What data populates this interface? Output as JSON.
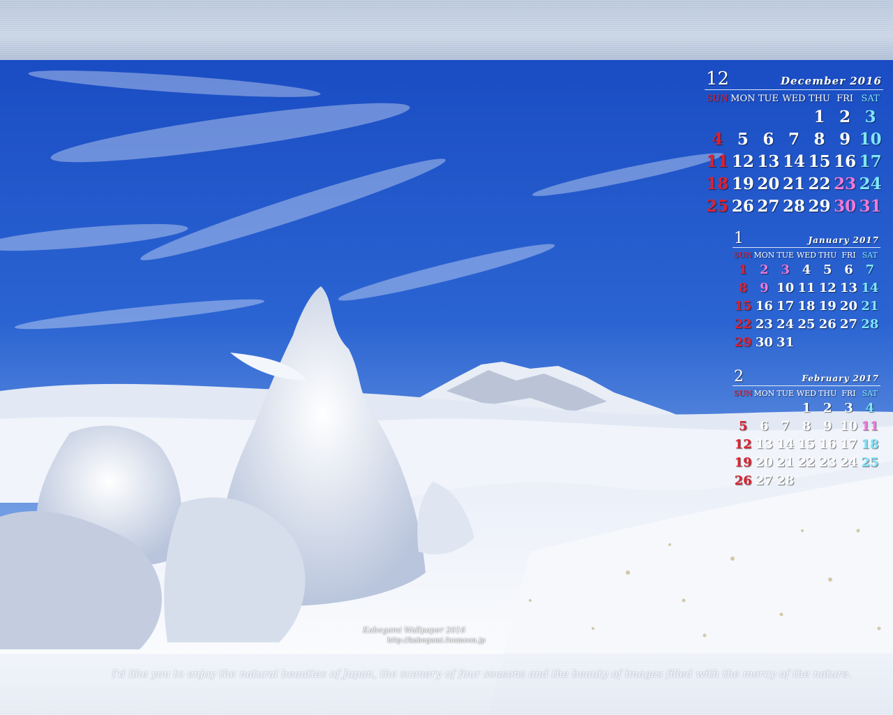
{
  "photo": {
    "description_icon": "snowy-mountain-photo-icon",
    "colors": {
      "sky_top": "#1a4fc4",
      "sky_bottom": "#6f9ee6",
      "snow": "#f2f5fb",
      "cloud": "#e4ebf6"
    }
  },
  "calendars": [
    {
      "month_number": "12",
      "month_name": "December 2016",
      "weekdays": [
        "SUN",
        "MON",
        "TUE",
        "WED",
        "THU",
        "FRI",
        "SAT"
      ],
      "weeks": [
        [
          {
            "d": "",
            "c": "wd"
          },
          {
            "d": "",
            "c": "wd"
          },
          {
            "d": "",
            "c": "wd"
          },
          {
            "d": "",
            "c": "wd"
          },
          {
            "d": "1",
            "c": "wd"
          },
          {
            "d": "2",
            "c": "wd"
          },
          {
            "d": "3",
            "c": "sat"
          }
        ],
        [
          {
            "d": "4",
            "c": "sun"
          },
          {
            "d": "5",
            "c": "wd"
          },
          {
            "d": "6",
            "c": "wd"
          },
          {
            "d": "7",
            "c": "wd"
          },
          {
            "d": "8",
            "c": "wd"
          },
          {
            "d": "9",
            "c": "wd"
          },
          {
            "d": "10",
            "c": "sat"
          }
        ],
        [
          {
            "d": "11",
            "c": "sun"
          },
          {
            "d": "12",
            "c": "wd"
          },
          {
            "d": "13",
            "c": "wd"
          },
          {
            "d": "14",
            "c": "wd"
          },
          {
            "d": "15",
            "c": "wd"
          },
          {
            "d": "16",
            "c": "wd"
          },
          {
            "d": "17",
            "c": "sat"
          }
        ],
        [
          {
            "d": "18",
            "c": "sun"
          },
          {
            "d": "19",
            "c": "wd"
          },
          {
            "d": "20",
            "c": "wd"
          },
          {
            "d": "21",
            "c": "wd"
          },
          {
            "d": "22",
            "c": "wd"
          },
          {
            "d": "23",
            "c": "hol"
          },
          {
            "d": "24",
            "c": "sat"
          }
        ],
        [
          {
            "d": "25",
            "c": "sun"
          },
          {
            "d": "26",
            "c": "wd"
          },
          {
            "d": "27",
            "c": "wd"
          },
          {
            "d": "28",
            "c": "wd"
          },
          {
            "d": "29",
            "c": "wd"
          },
          {
            "d": "30",
            "c": "hol"
          },
          {
            "d": "31",
            "c": "hol"
          }
        ]
      ]
    },
    {
      "month_number": "1",
      "month_name": "January 2017",
      "weekdays": [
        "SUN",
        "MON",
        "TUE",
        "WED",
        "THU",
        "FRI",
        "SAT"
      ],
      "weeks": [
        [
          {
            "d": "1",
            "c": "sun"
          },
          {
            "d": "2",
            "c": "hol"
          },
          {
            "d": "3",
            "c": "hol"
          },
          {
            "d": "4",
            "c": "wd"
          },
          {
            "d": "5",
            "c": "wd"
          },
          {
            "d": "6",
            "c": "wd"
          },
          {
            "d": "7",
            "c": "sat"
          }
        ],
        [
          {
            "d": "8",
            "c": "sun"
          },
          {
            "d": "9",
            "c": "hol"
          },
          {
            "d": "10",
            "c": "wd"
          },
          {
            "d": "11",
            "c": "wd"
          },
          {
            "d": "12",
            "c": "wd"
          },
          {
            "d": "13",
            "c": "wd"
          },
          {
            "d": "14",
            "c": "sat"
          }
        ],
        [
          {
            "d": "15",
            "c": "sun"
          },
          {
            "d": "16",
            "c": "wd"
          },
          {
            "d": "17",
            "c": "wd"
          },
          {
            "d": "18",
            "c": "wd"
          },
          {
            "d": "19",
            "c": "wd"
          },
          {
            "d": "20",
            "c": "wd"
          },
          {
            "d": "21",
            "c": "sat"
          }
        ],
        [
          {
            "d": "22",
            "c": "sun"
          },
          {
            "d": "23",
            "c": "wd"
          },
          {
            "d": "24",
            "c": "wd"
          },
          {
            "d": "25",
            "c": "wd"
          },
          {
            "d": "26",
            "c": "wd"
          },
          {
            "d": "27",
            "c": "wd"
          },
          {
            "d": "28",
            "c": "sat"
          }
        ],
        [
          {
            "d": "29",
            "c": "sun"
          },
          {
            "d": "30",
            "c": "wd"
          },
          {
            "d": "31",
            "c": "wd"
          },
          {
            "d": "",
            "c": "wd"
          },
          {
            "d": "",
            "c": "wd"
          },
          {
            "d": "",
            "c": "wd"
          },
          {
            "d": "",
            "c": "wd"
          }
        ]
      ]
    },
    {
      "month_number": "2",
      "month_name": "February 2017",
      "weekdays": [
        "SUN",
        "MON",
        "TUE",
        "WED",
        "THU",
        "FRI",
        "SAT"
      ],
      "weeks": [
        [
          {
            "d": "",
            "c": "wd"
          },
          {
            "d": "",
            "c": "wd"
          },
          {
            "d": "",
            "c": "wd"
          },
          {
            "d": "1",
            "c": "wd"
          },
          {
            "d": "2",
            "c": "wd"
          },
          {
            "d": "3",
            "c": "wd"
          },
          {
            "d": "4",
            "c": "sat"
          }
        ],
        [
          {
            "d": "5",
            "c": "sun"
          },
          {
            "d": "6",
            "c": "wd"
          },
          {
            "d": "7",
            "c": "wd"
          },
          {
            "d": "8",
            "c": "wd"
          },
          {
            "d": "9",
            "c": "wd"
          },
          {
            "d": "10",
            "c": "wd"
          },
          {
            "d": "11",
            "c": "hol"
          }
        ],
        [
          {
            "d": "12",
            "c": "sun"
          },
          {
            "d": "13",
            "c": "wd"
          },
          {
            "d": "14",
            "c": "wd"
          },
          {
            "d": "15",
            "c": "wd"
          },
          {
            "d": "16",
            "c": "wd"
          },
          {
            "d": "17",
            "c": "wd"
          },
          {
            "d": "18",
            "c": "sat"
          }
        ],
        [
          {
            "d": "19",
            "c": "sun"
          },
          {
            "d": "20",
            "c": "wd"
          },
          {
            "d": "21",
            "c": "wd"
          },
          {
            "d": "22",
            "c": "wd"
          },
          {
            "d": "23",
            "c": "wd"
          },
          {
            "d": "24",
            "c": "wd"
          },
          {
            "d": "25",
            "c": "sat"
          }
        ],
        [
          {
            "d": "26",
            "c": "sun"
          },
          {
            "d": "27",
            "c": "wd"
          },
          {
            "d": "28",
            "c": "wd"
          },
          {
            "d": "",
            "c": "wd"
          },
          {
            "d": "",
            "c": "wd"
          },
          {
            "d": "",
            "c": "wd"
          },
          {
            "d": "",
            "c": "wd"
          }
        ]
      ]
    }
  ],
  "credit": "Kabegami Wallpaper 2016",
  "url": "http://kabegami.fuumoon.jp",
  "quote": "I'd like you to enjoy the natural beauties of Japan, the scenery of four seasons and the beauty of images filled with the mercy of the nature."
}
